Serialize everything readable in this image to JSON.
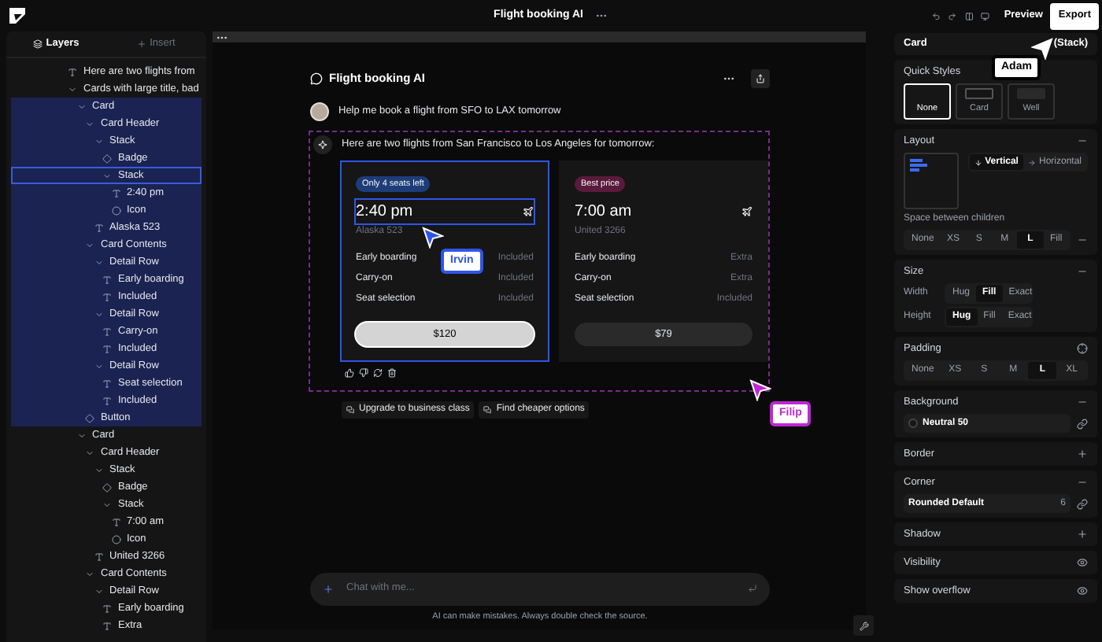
{
  "layers_panel": {
    "tabs": [
      {
        "label": "Layers",
        "selected": true
      },
      {
        "label": "Insert",
        "selected": false
      }
    ],
    "tree": [
      {
        "label": "Here are two flights from",
        "kind": "text",
        "selected": false,
        "hovered": false
      },
      {
        "label": "Cards with large title, bad",
        "kind": "group",
        "expanded": true,
        "selected": false,
        "hovered": false,
        "children": [
          {
            "label": "Card",
            "kind": "group",
            "expanded": true,
            "selected": true,
            "hovered": false,
            "children": [
              {
                "label": "Card Header",
                "kind": "group",
                "expanded": true,
                "selected": true,
                "hovered": false,
                "children": [
                  {
                    "label": "Stack",
                    "kind": "group",
                    "expanded": true,
                    "selected": true,
                    "hovered": false,
                    "children": [
                      {
                        "label": "Badge",
                        "kind": "component",
                        "selected": true,
                        "hovered": false
                      },
                      {
                        "label": "Stack",
                        "kind": "group",
                        "expanded": true,
                        "selected": true,
                        "hovered": true,
                        "children": [
                          {
                            "label": "2:40 pm",
                            "kind": "text",
                            "selected": true,
                            "hovered": false
                          },
                          {
                            "label": "Icon",
                            "kind": "icon",
                            "selected": true,
                            "hovered": false
                          }
                        ]
                      }
                    ]
                  },
                  {
                    "label": "Alaska 523",
                    "kind": "text",
                    "selected": true,
                    "hovered": false
                  }
                ]
              },
              {
                "label": "Card Contents",
                "kind": "group",
                "expanded": true,
                "selected": true,
                "hovered": false,
                "children": [
                  {
                    "label": "Detail Row",
                    "kind": "group",
                    "expanded": true,
                    "selected": true,
                    "hovered": false,
                    "children": [
                      {
                        "label": "Early boarding",
                        "kind": "text",
                        "selected": true,
                        "hovered": false
                      },
                      {
                        "label": "Included",
                        "kind": "text",
                        "selected": true,
                        "hovered": false
                      }
                    ]
                  },
                  {
                    "label": "Detail Row",
                    "kind": "group",
                    "expanded": true,
                    "selected": true,
                    "hovered": false,
                    "children": [
                      {
                        "label": "Carry-on",
                        "kind": "text",
                        "selected": true,
                        "hovered": false
                      },
                      {
                        "label": "Included",
                        "kind": "text",
                        "selected": true,
                        "hovered": false
                      }
                    ]
                  },
                  {
                    "label": "Detail Row",
                    "kind": "group",
                    "expanded": true,
                    "selected": true,
                    "hovered": false,
                    "children": [
                      {
                        "label": "Seat selection",
                        "kind": "text",
                        "selected": true,
                        "hovered": false
                      },
                      {
                        "label": "Included",
                        "kind": "text",
                        "selected": true,
                        "hovered": false
                      }
                    ]
                  }
                ]
              },
              {
                "label": "Button",
                "kind": "component",
                "selected": true,
                "hovered": false
              }
            ]
          },
          {
            "label": "Card",
            "kind": "group",
            "expanded": true,
            "selected": false,
            "hovered": false,
            "children": [
              {
                "label": "Card Header",
                "kind": "group",
                "expanded": true,
                "selected": false,
                "hovered": false,
                "children": [
                  {
                    "label": "Stack",
                    "kind": "group",
                    "expanded": true,
                    "selected": false,
                    "hovered": false,
                    "children": [
                      {
                        "label": "Badge",
                        "kind": "component",
                        "selected": false,
                        "hovered": false
                      },
                      {
                        "label": "Stack",
                        "kind": "group",
                        "expanded": true,
                        "selected": false,
                        "hovered": false,
                        "children": [
                          {
                            "label": "7:00 am",
                            "kind": "text",
                            "selected": false,
                            "hovered": false
                          },
                          {
                            "label": "Icon",
                            "kind": "icon",
                            "selected": false,
                            "hovered": false
                          }
                        ]
                      }
                    ]
                  },
                  {
                    "label": "United 3266",
                    "kind": "text",
                    "selected": false,
                    "hovered": false
                  }
                ]
              },
              {
                "label": "Card Contents",
                "kind": "group",
                "expanded": true,
                "selected": false,
                "hovered": false,
                "children": [
                  {
                    "label": "Detail Row",
                    "kind": "group",
                    "expanded": true,
                    "selected": false,
                    "hovered": false,
                    "children": [
                      {
                        "label": "Early boarding",
                        "kind": "text",
                        "selected": false,
                        "hovered": false
                      },
                      {
                        "label": "Extra",
                        "kind": "text",
                        "selected": false,
                        "hovered": false
                      }
                    ]
                  }
                ]
              }
            ]
          }
        ]
      }
    ]
  },
  "top_bar": {
    "title": "Flight booking AI"
  },
  "toolbar": {
    "preview": "Preview",
    "export": "Export"
  },
  "chat": {
    "title": "Flight booking AI",
    "user_message": "Help me book a flight from SFO to LAX tomorrow",
    "assistant_message": "Here are two flights from San Francisco to Los Angeles for tomorrow:",
    "flights": [
      {
        "badge": "Only 4 seats left",
        "color": "#1d3d7a",
        "time": "2:40 pm",
        "flight": "Alaska 523",
        "selected": true,
        "highlighted": true,
        "primary": true,
        "price": "$120",
        "details": [
          {
            "label": "Early boarding",
            "value": "Included"
          },
          {
            "label": "Carry-on",
            "value": "Included"
          },
          {
            "label": "Seat selection",
            "value": "Included"
          }
        ]
      },
      {
        "badge": "Best price",
        "color": "#5a1a3c",
        "time": "7:00 am",
        "flight": "United 3266",
        "selected": false,
        "highlighted": false,
        "primary": false,
        "price": "$79",
        "details": [
          {
            "label": "Early boarding",
            "value": "Extra"
          },
          {
            "label": "Carry-on",
            "value": "Extra"
          },
          {
            "label": "Seat selection",
            "value": "Included"
          }
        ]
      }
    ],
    "suggestions": [
      "Upgrade to business class",
      "Find cheaper options"
    ],
    "input_placeholder": "Chat with me...",
    "disclaimer": "AI can make mistakes. Always double check the source."
  },
  "cursors": [
    {
      "name": "Irvin",
      "color": "#2f55e8"
    },
    {
      "name": "Filip",
      "color": "#c026d3"
    },
    {
      "name": "Adam",
      "color": "#ffffff"
    }
  ],
  "inspector": {
    "component": "Card",
    "type": "(Stack)",
    "sections": [
      {
        "kind": "styles",
        "title": "Quick Styles",
        "options": [
          {
            "label": "None",
            "selected": true
          },
          {
            "label": "Card",
            "selected": false
          },
          {
            "label": "Well",
            "selected": false
          }
        ]
      },
      {
        "kind": "layout",
        "title": "Layout",
        "expanded": true,
        "directions": [
          {
            "label": "Vertical",
            "selected": true
          },
          {
            "label": "Horizontal",
            "selected": false
          }
        ],
        "spacing_label": "Space between children",
        "spacing": [
          {
            "label": "None",
            "selected": false
          },
          {
            "label": "XS",
            "selected": false
          },
          {
            "label": "S",
            "selected": false
          },
          {
            "label": "M",
            "selected": false
          },
          {
            "label": "L",
            "selected": true
          },
          {
            "label": "Fill",
            "selected": false
          }
        ]
      },
      {
        "kind": "size",
        "title": "Size",
        "expanded": true,
        "rows": [
          {
            "label": "Width",
            "options": [
              {
                "label": "Hug",
                "selected": false
              },
              {
                "label": "Fill",
                "selected": true
              },
              {
                "label": "Exact",
                "selected": false
              }
            ]
          },
          {
            "label": "Height",
            "options": [
              {
                "label": "Hug",
                "selected": true
              },
              {
                "label": "Fill",
                "selected": false
              },
              {
                "label": "Exact",
                "selected": false
              }
            ]
          }
        ]
      },
      {
        "kind": "padding",
        "title": "Padding",
        "options": [
          {
            "label": "None",
            "selected": false
          },
          {
            "label": "XS",
            "selected": false
          },
          {
            "label": "S",
            "selected": false
          },
          {
            "label": "M",
            "selected": false
          },
          {
            "label": "L",
            "selected": true
          },
          {
            "label": "XL",
            "selected": false
          }
        ]
      },
      {
        "kind": "fill",
        "title": "Background",
        "expanded": true,
        "value": "Neutral 50"
      },
      {
        "kind": "fill",
        "title": "Border",
        "expanded": false
      },
      {
        "kind": "corner",
        "title": "Corner",
        "expanded": true,
        "value": "Rounded Default",
        "radius": "6"
      },
      {
        "kind": "fill",
        "title": "Shadow",
        "expanded": false
      },
      {
        "kind": "toggle",
        "title": "Visibility",
        "on": true
      },
      {
        "kind": "toggle",
        "title": "Show overflow",
        "on": true
      }
    ]
  }
}
